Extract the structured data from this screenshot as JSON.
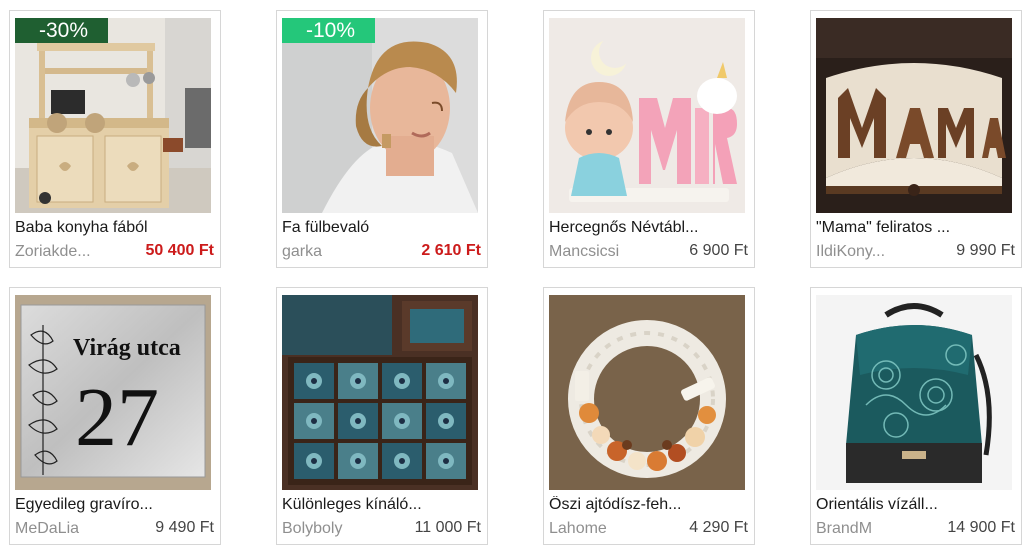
{
  "products": [
    {
      "title": "Baba konyha fából",
      "seller": "Zoriakde...",
      "price": "50 400 Ft",
      "badge": "-30%",
      "badge_color": "#1f5f31",
      "sale": true,
      "image": "wooden-play-kitchen-photo"
    },
    {
      "title": "Fa fülbevaló",
      "seller": "garka",
      "price": "2 610 Ft",
      "badge": "-10%",
      "badge_color": "#24c77a",
      "sale": true,
      "image": "wooden-earring-model-photo"
    },
    {
      "title": "Hercegnős Névtábl...",
      "seller": "Mancsicsi",
      "price": "6 900 Ft",
      "badge": "",
      "sale": false,
      "image": "princess-name-sign-photo"
    },
    {
      "title": "\"Mama\" feliratos ...",
      "seller": "IldiKony...",
      "price": "9 990 Ft",
      "badge": "",
      "sale": false,
      "image": "folded-book-art-photo"
    },
    {
      "title": "Egyedileg gravíro...",
      "seller": "MeDaLia",
      "price": "9 490 Ft",
      "badge": "",
      "sale": false,
      "image": "engraved-house-number-sign-photo",
      "image_text": [
        "Virág utca",
        "27"
      ]
    },
    {
      "title": "Különleges kínáló...",
      "seller": "Bolyboly",
      "price": "11 000 Ft",
      "badge": "",
      "sale": false,
      "image": "mosaic-tile-tray-photo"
    },
    {
      "title": "Őszi ajtódísz-feh...",
      "seller": "Lahome",
      "price": "4 290 Ft",
      "badge": "",
      "sale": false,
      "image": "autumn-door-wreath-photo"
    },
    {
      "title": "Orientális vízáll...",
      "seller": "BrandM",
      "price": "14 900 Ft",
      "badge": "",
      "sale": false,
      "image": "oriental-backpack-photo"
    }
  ]
}
